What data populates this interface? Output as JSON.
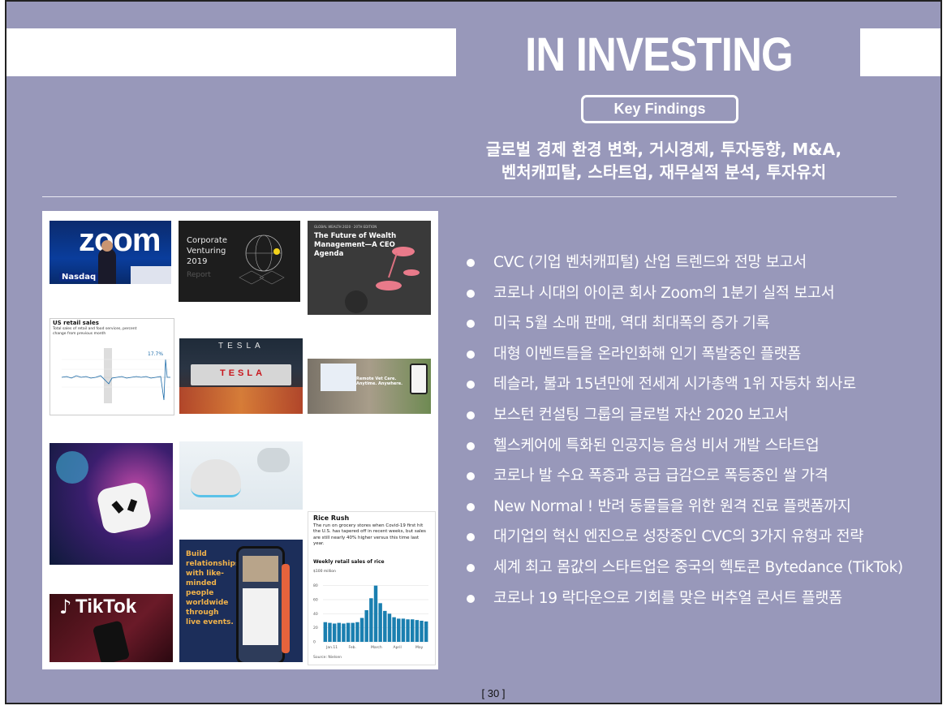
{
  "header": {
    "title": "IN INVESTING",
    "key_findings": "Key Findings",
    "subtitle_line1": "글로벌 경제 환경 변화, 거시경제, 투자동향, M&A,",
    "subtitle_line2": "벤처캐피탈, 스타트업, 재무실적 분석, 투자유치"
  },
  "collage": {
    "zoom_logo": "zoom",
    "zoom_caption": "Nasdaq",
    "cvc_title": "Corporate Venturing 2019",
    "cvc_sub": "Report",
    "bcg_title": "The Future of Wealth Management—A CEO Agenda",
    "bcg_top": "GLOBAL WEALTH 2020 · 20TH EDITION",
    "retail_title": "US retail sales",
    "retail_sub": "Total sales of retail and food services, percent change from previous month",
    "retail_callout": "17.7%",
    "tesla_sign": "TESLA",
    "tesla_sign2": "TESLA",
    "vet_caption": "Remote Vet Care. Anytime. Anywhere.",
    "pet_build": "Build relationships with like-minded people worldwide through live events.",
    "tiktok_logo": "TikTok",
    "rice_title": "Rice Rush",
    "rice_text": "The run on grocery stores when Covid-19 first hit the U.S. has tapered off in recent weeks, but sales are still nearly 40% higher versus this time last year.",
    "rice_chart_title": "Weekly retail sales of rice",
    "rice_unit": "$100 million",
    "rice_source": "Source: Nielsen",
    "rice_xticks": [
      "Jan.11",
      "Feb.",
      "March",
      "April",
      "May"
    ],
    "rice_yticks": [
      "80",
      "60",
      "40",
      "20",
      "0"
    ]
  },
  "bullets": [
    "CVC (기업 벤처캐피털) 산업 트렌드와 전망 보고서",
    "코로나 시대의 아이콘 회사 Zoom의 1분기 실적 보고서",
    "미국 5월 소매 판매, 역대 최대폭의 증가 기록",
    "대형 이벤트들을 온라인화해 인기 폭발중인 플랫폼",
    "테슬라, 불과 15년만에 전세계 시가총액 1위 자동차 회사로",
    "보스턴 컨설팅 그룹의 글로벌 자산 2020 보고서",
    "헬스케어에 특화된 인공지능 음성 비서 개발 스타트업",
    "코로나 발 수요 폭증과 공급 급감으로 폭등중인 쌀 가격",
    "New Normal ! 반려 동물들을 위한 원격 진료 플랫폼까지",
    "대기업의 혁신 엔진으로 성장중인 CVC의 3가지 유형과 전략",
    "세계 최고 몸값의 스타트업은 중국의 헥토콘 Bytedance (TikTok)",
    "코로나 19 락다운으로 기회를 맞은 버추얼 콘서트 플랫폼"
  ],
  "page_number": "[ 30 ]",
  "rice_values": [
    28,
    27,
    26,
    27,
    26,
    27,
    27,
    28,
    34,
    45,
    62,
    80,
    55,
    44,
    40,
    35,
    33,
    33,
    32,
    32,
    31,
    30,
    29
  ]
}
